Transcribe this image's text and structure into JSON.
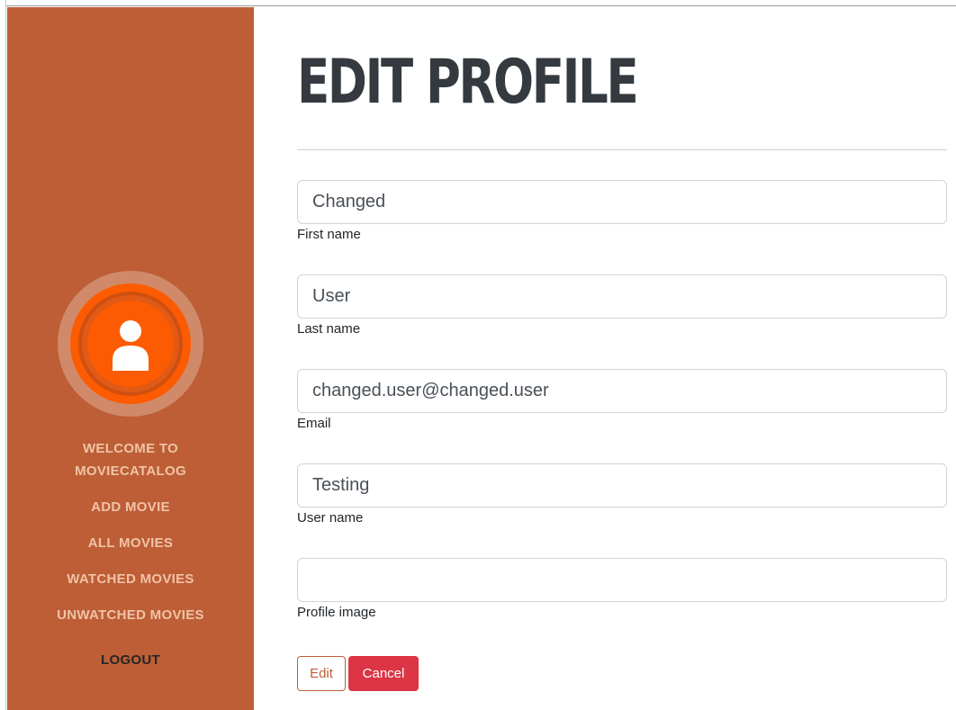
{
  "sidebar": {
    "avatar_icon": "user-icon",
    "nav": {
      "welcome": "WELCOME TO MOVIECATALOG",
      "add_movie": "ADD MOVIE",
      "all_movies": "ALL MOVIES",
      "watched_movies": "WATCHED MOVIES",
      "unwatched_movies": "UNWATCHED MOVIES",
      "logout": "LOGOUT"
    }
  },
  "main": {
    "title": "EDIT PROFILE",
    "fields": {
      "first_name": {
        "value": "Changed",
        "label": "First name"
      },
      "last_name": {
        "value": "User",
        "label": "Last name"
      },
      "email": {
        "value": "changed.user@changed.user",
        "label": "Email"
      },
      "user_name": {
        "value": "Testing",
        "label": "User name"
      },
      "profile_image": {
        "value": "",
        "label": "Profile image"
      }
    },
    "actions": {
      "edit_label": "Edit",
      "cancel_label": "Cancel"
    }
  },
  "colors": {
    "sidebar_bg": "#bd5e37",
    "avatar_orange": "#fd5b02",
    "nav_text": "#f1c3a6",
    "cancel_red": "#dc3545",
    "title_dark": "#343a40"
  }
}
